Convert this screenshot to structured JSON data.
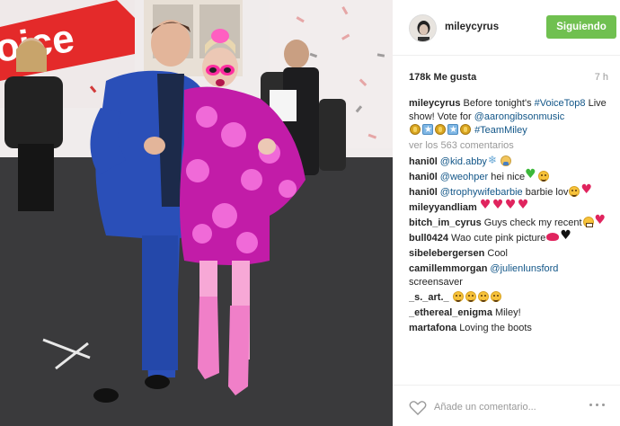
{
  "post": {
    "image_alt": "Photo",
    "owner": {
      "username": "mileycyrus",
      "avatar_icon": "avatar-icon"
    },
    "follow_button_label": "Siguiendo",
    "likes_text": "178k Me gusta",
    "time_ago": "7 h",
    "caption": {
      "username": "mileycyrus",
      "text_1": "Before tonight's ",
      "hashtag_1": "#VoiceTop8",
      "text_2": " Live show! Vote for ",
      "mention_1": "@aarongibsonmusic",
      "hashtag_2": "#TeamMiley"
    },
    "view_all_text": "ver los 563 comentarios",
    "comments": [
      {
        "username": "hani0l",
        "link": "@kid.abby",
        "text": "",
        "emojis": [
          "emoji-snow",
          "emoji-person"
        ]
      },
      {
        "username": "hani0l",
        "link": "@weohper",
        "text": " hei nice",
        "emojis": [
          "emoji-green-heart",
          "emoji-face"
        ]
      },
      {
        "username": "hani0l",
        "link": "@trophywifebarbie",
        "text": " barbie lov",
        "emojis": [
          "emoji-face",
          "emoji-heart"
        ]
      },
      {
        "username": "mileyyandliam",
        "link": "",
        "text": "",
        "emojis": [
          "emoji-heart",
          "emoji-heart",
          "emoji-heart",
          "emoji-heart"
        ]
      },
      {
        "username": "bitch_im_cyrus",
        "link": "",
        "text": "Guys check my recent",
        "emojis": [
          "emoji-grimace",
          "emoji-heart"
        ]
      },
      {
        "username": "bull0424",
        "link": "",
        "text": "Wao cute pink picture",
        "emojis": [
          "emoji-lips",
          "emoji-black-heart"
        ]
      },
      {
        "username": "sibelebergersen",
        "link": "",
        "text": "Cool",
        "emojis": []
      },
      {
        "username": "camillemmorgan",
        "link": "@julienlunsford",
        "text": " screensaver",
        "emojis": []
      },
      {
        "username": "_s._art._",
        "link": "",
        "text": "",
        "emojis": [
          "emoji-face",
          "emoji-face",
          "emoji-face",
          "emoji-face"
        ]
      },
      {
        "username": "_ethereal_enigma",
        "link": "",
        "text": "Miley!",
        "emojis": []
      },
      {
        "username": "martafona",
        "link": "",
        "text": "Loving the boots",
        "emojis": []
      }
    ],
    "add_comment_placeholder": "Añade un comentario...",
    "icons": {
      "like": "heart-outline-icon",
      "more": "more-options-icon"
    },
    "colors": {
      "follow_green": "#70c050",
      "link_blue": "#125688",
      "muted": "#999999"
    }
  }
}
